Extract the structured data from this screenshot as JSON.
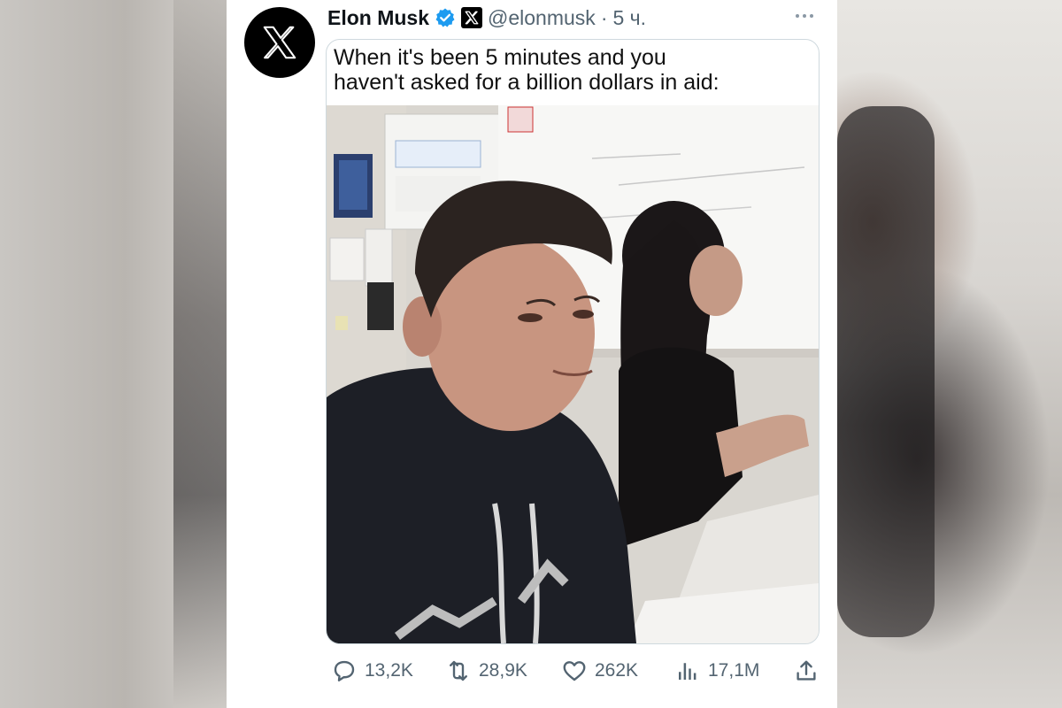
{
  "tweet": {
    "author_name": "Elon Musk",
    "handle": "@elonmusk",
    "separator": "·",
    "time": "5 ч.",
    "text_lines": [
      "When it's been 5 minutes and you",
      "haven't asked for a billion dollars in aid:"
    ]
  },
  "icons": {
    "avatar": "x-logo-icon",
    "verified": "verified-badge-icon",
    "affiliate": "x-logo-icon",
    "more": "more-horizontal-icon",
    "reply": "reply-icon",
    "repost": "repost-icon",
    "like": "heart-icon",
    "views": "views-bar-chart-icon",
    "share": "share-icon"
  },
  "colors": {
    "verified_blue": "#1d9bf0",
    "text_primary": "#0f1419",
    "text_secondary": "#536471"
  },
  "actions": {
    "replies": "13,2K",
    "reposts": "28,9K",
    "likes": "262K",
    "views": "17,1M"
  }
}
